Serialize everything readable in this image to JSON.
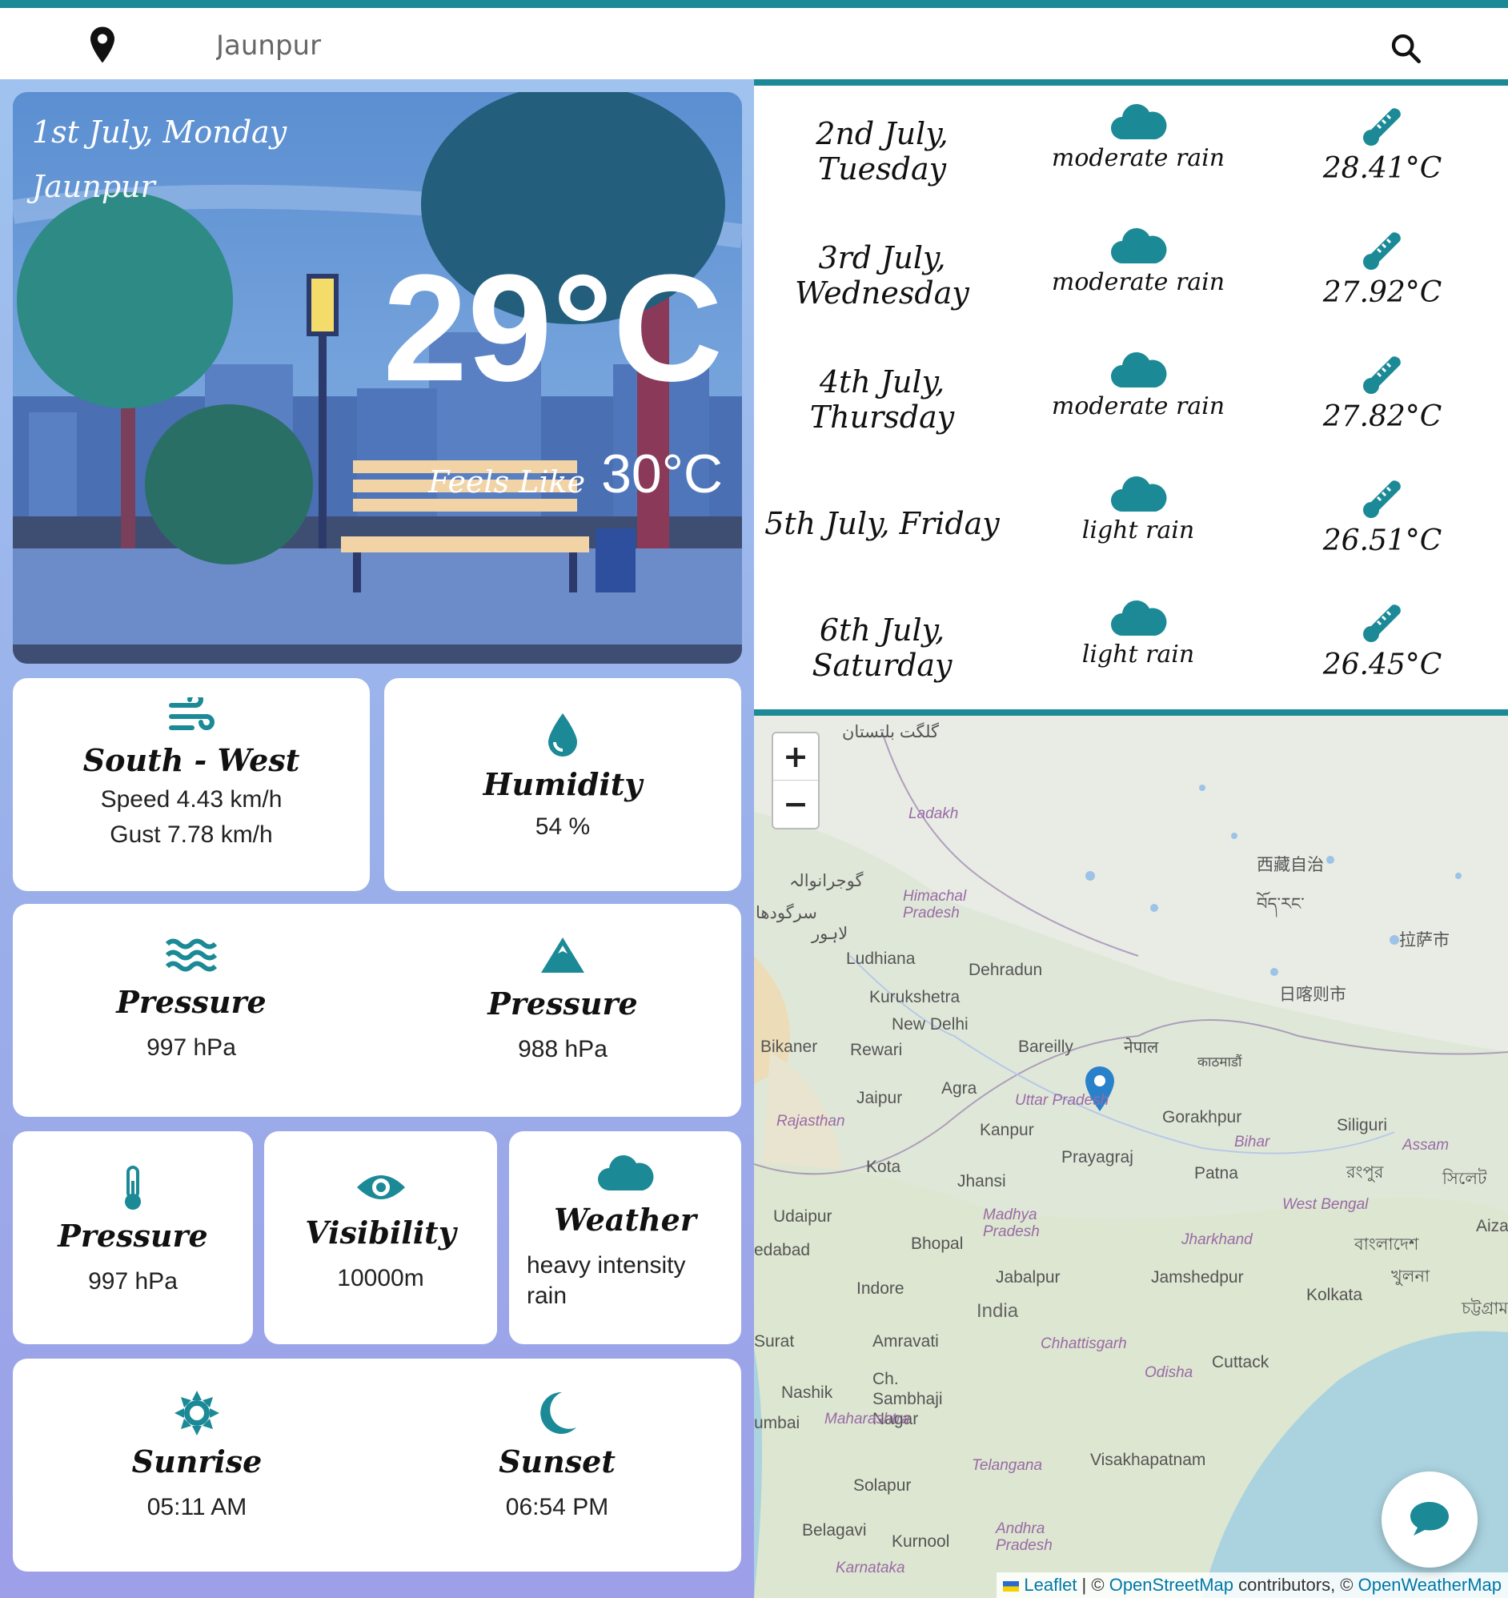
{
  "header": {
    "search_value": "Jaunpur",
    "icons": {
      "location": "location-pin-icon",
      "search": "search-icon"
    }
  },
  "current": {
    "date": "1st July, Monday",
    "city": "Jaunpur",
    "temp": "29°C",
    "feels_label": "Feels Like",
    "feels_value": "30°C"
  },
  "wind": {
    "direction": "South - West",
    "speed": "Speed 4.43 km/h",
    "gust": "Gust 7.78 km/h"
  },
  "humidity": {
    "label": "Humidity",
    "value": "54 %"
  },
  "pressure_sea": {
    "label": "Pressure",
    "value": "997 hPa"
  },
  "pressure_ground": {
    "label": "Pressure",
    "value": "988 hPa"
  },
  "pressure_temp": {
    "label": "Pressure",
    "value": "997 hPa"
  },
  "visibility": {
    "label": "Visibility",
    "value": "10000m"
  },
  "weather": {
    "label": "Weather",
    "value": "heavy intensity rain"
  },
  "sun": {
    "sunrise_label": "Sunrise",
    "sunrise": "05:11 AM",
    "sunset_label": "Sunset",
    "sunset": "06:54 PM"
  },
  "forecast": [
    {
      "date": "2nd July, Tuesday",
      "desc": "moderate rain",
      "temp": "28.41°C"
    },
    {
      "date": "3rd July, Wednesday",
      "desc": "moderate rain",
      "temp": "27.92°C"
    },
    {
      "date": "4th July, Thursday",
      "desc": "moderate rain",
      "temp": "27.82°C"
    },
    {
      "date": "5th July, Friday",
      "desc": "light rain",
      "temp": "26.51°C"
    },
    {
      "date": "6th July, Saturday",
      "desc": "light rain",
      "temp": "26.45°C"
    }
  ],
  "map": {
    "zoom_in": "+",
    "zoom_out": "−",
    "labels": {
      "ladakh": "Ladakh",
      "himachal": "Himachal Pradesh",
      "ludhiana": "Ludhiana",
      "dehradun": "Dehradun",
      "kurukshetra": "Kurukshetra",
      "new_delhi": "New Delhi",
      "bikaner": "Bikaner",
      "rewari": "Rewari",
      "bareilly": "Bareilly",
      "jaipur": "Jaipur",
      "agra": "Agra",
      "uttar_pradesh": "Uttar Pradesh",
      "rajasthan": "Rajasthan",
      "kanpur": "Kanpur",
      "prayagraj": "Prayagraj",
      "gorakhpur": "Gorakhpur",
      "kota": "Kota",
      "jhansi": "Jhansi",
      "patna": "Patna",
      "bihar": "Bihar",
      "siliguri": "Siliguri",
      "assam": "Assam",
      "udaipur": "Udaipur",
      "madhya_pradesh": "Madhya Pradesh",
      "west_bengal": "West Bengal",
      "bhopal": "Bhopal",
      "jharkhand": "Jharkhand",
      "jabalpur": "Jabalpur",
      "jamshedpur": "Jamshedpur",
      "indore": "Indore",
      "india": "India",
      "kolkata": "Kolkata",
      "surat": "Surat",
      "amravati": "Amravati",
      "chhattisgarh": "Chhattisgarh",
      "odisha": "Odisha",
      "cuttack": "Cuttack",
      "ch_sambhaji": "Ch. Sambhaji Nagar",
      "nashik": "Nashik",
      "maharashtra": "Maharashtra",
      "telangana": "Telangana",
      "visakhapatnam": "Visakhapatnam",
      "solapur": "Solapur",
      "belagavi": "Belagavi",
      "kurnool": "Kurnool",
      "andhra": "Andhra Pradesh",
      "karnataka": "Karnataka",
      "edabad": "edabad",
      "umbai": "umbai",
      "tibet": "西藏自治",
      "lhasa": "拉萨市",
      "shigatse": "日喀则市",
      "nepal": "नेपाल",
      "kathmandu": "काठमाडौं",
      "tibet_script": "བོད་རང་",
      "bangla": "বাংলাদেশ",
      "khulna": "খুলনা",
      "rangpur": "রংপুর",
      "sylhet": "সিলেট",
      "chattogram": "চট্টগ্রাম",
      "lahore": "لاہور",
      "gujranwala": "گوجرانوالہ",
      "sargodha": "سرگودھا",
      "gilgit": "گلگت بلتستان",
      "aizawl": "Aizav"
    },
    "attribution": {
      "leaflet": "Leaflet",
      "sep": " | © ",
      "osm": "OpenStreetMap",
      "mid": " contributors, © ",
      "owm": "OpenWeatherMap"
    }
  },
  "chat_icon": "chat-bubble-icon",
  "colors": {
    "accent": "#1b8a96",
    "marker": "#2a81cb"
  }
}
